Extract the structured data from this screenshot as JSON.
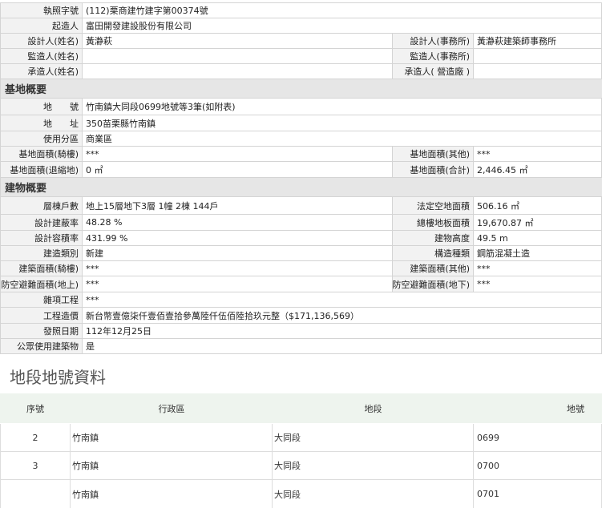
{
  "top": [
    {
      "label": "執照字號",
      "value": "(112)栗商建竹建字第00374號"
    },
    {
      "label": "起造人",
      "value": "富田開發建設股份有限公司"
    }
  ],
  "top_pairs": [
    {
      "l1": "設計人(姓名)",
      "v1": "黃瀞萩",
      "l2": "設計人(事務所)",
      "v2": "黃瀞萩建築師事務所"
    },
    {
      "l1": "監造人(姓名)",
      "v1": "",
      "l2": "監造人(事務所)",
      "v2": ""
    },
    {
      "l1": "承造人(姓名)",
      "v1": "",
      "l2": "承造人( 營造廠 )",
      "v2": ""
    }
  ],
  "base": {
    "title": "基地概要",
    "singles": [
      {
        "label": "地　　號",
        "value": "竹南鎮大同段0699地號等3筆(如附表)"
      },
      {
        "label": "地　　址",
        "value": "350苗栗縣竹南鎮"
      },
      {
        "label": "使用分區",
        "value": "商業區"
      }
    ],
    "pairs": [
      {
        "l1": "基地面積(騎樓)",
        "v1": "***",
        "l2": "基地面積(其他)",
        "v2": "***"
      },
      {
        "l1": "基地面積(退縮地)",
        "v1": "0 ㎡",
        "l2": "基地面積(合計)",
        "v2": "2,446.45 ㎡"
      }
    ]
  },
  "building": {
    "title": "建物概要",
    "pairs": [
      {
        "l1": "層棟戶數",
        "v1": "地上15層地下3層 1幢 2棟 144戶",
        "l2": "法定空地面積",
        "v2": "506.16 ㎡"
      },
      {
        "l1": "設計建蔽率",
        "v1": "48.28 %",
        "l2": "總樓地板面積",
        "v2": "19,670.87 ㎡"
      },
      {
        "l1": "設計容積率",
        "v1": "431.99 %",
        "l2": "建物高度",
        "v2": "49.5 m"
      },
      {
        "l1": "建造類別",
        "v1": "新建",
        "l2": "構造種類",
        "v2": "鋼筋混凝土造"
      },
      {
        "l1": "建築面積(騎樓)",
        "v1": "***",
        "l2": "建築面積(其他)",
        "v2": "***"
      },
      {
        "l1": "防空避難面積(地上)",
        "v1": "***",
        "l2": "防空避難面積(地下)",
        "v2": "***"
      }
    ],
    "singles": [
      {
        "label": "雜項工程",
        "value": "***"
      },
      {
        "label": "工程造價",
        "value": "新台幣壹億柒仟壹佰壹拾參萬陸仟伍佰陸拾玖元整（$171,136,569）"
      },
      {
        "label": "發照日期",
        "value": "112年12月25日"
      },
      {
        "label": "公眾使用建築物",
        "value": "是"
      }
    ]
  },
  "lots": {
    "title": "地段地號資料",
    "headers": {
      "seq": "序號",
      "district": "行政區",
      "section": "地段",
      "lot": "地號"
    },
    "rows": [
      {
        "seq": "2",
        "district": "竹南鎮",
        "section": "大同段",
        "lot": "0699"
      },
      {
        "seq": "3",
        "district": "竹南鎮",
        "section": "大同段",
        "lot": "0700"
      },
      {
        "seq": "",
        "district": "竹南鎮",
        "section": "大同段",
        "lot": "0701"
      }
    ]
  }
}
